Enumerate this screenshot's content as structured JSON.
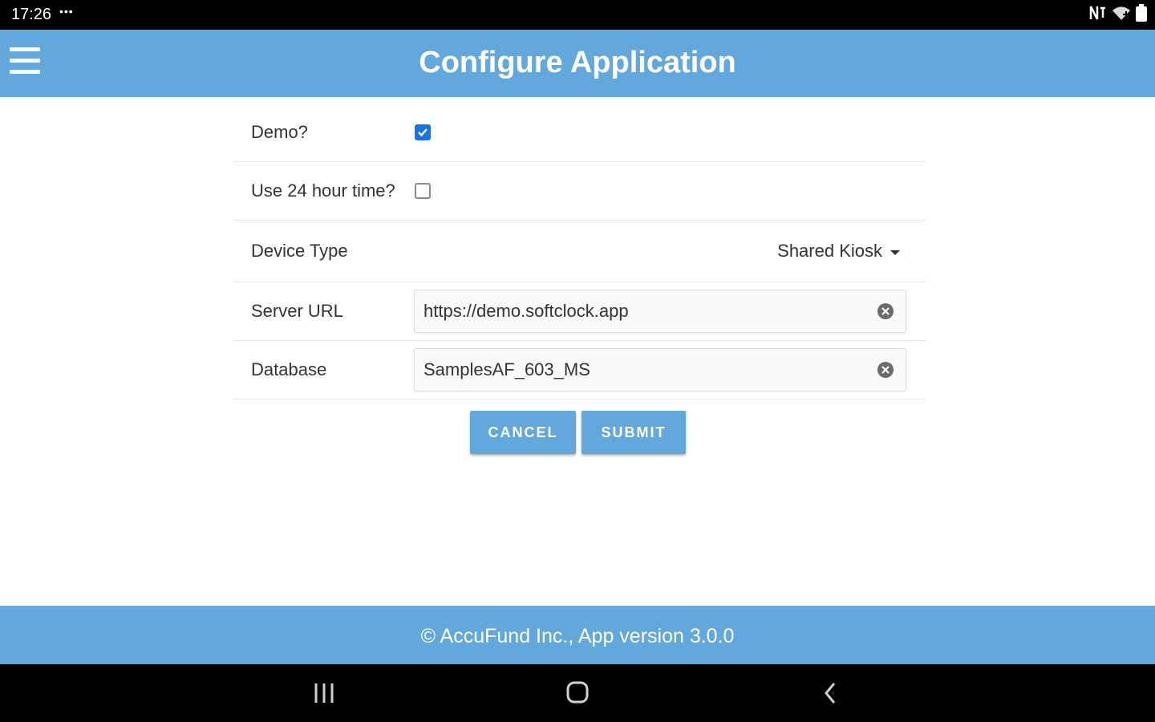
{
  "status_bar": {
    "time": "17:26",
    "dots": "•••"
  },
  "app_bar": {
    "title": "Configure Application"
  },
  "form": {
    "demo": {
      "label": "Demo?",
      "checked": true
    },
    "use_24h": {
      "label": "Use 24 hour time?",
      "checked": false
    },
    "device_type": {
      "label": "Device Type",
      "value": "Shared Kiosk"
    },
    "server_url": {
      "label": "Server URL",
      "value": "https://demo.softclock.app"
    },
    "database": {
      "label": "Database",
      "value": "SamplesAF_603_MS"
    }
  },
  "actions": {
    "cancel_label": "CANCEL",
    "submit_label": "SUBMIT"
  },
  "footer": {
    "text": "© AccuFund Inc., App version 3.0.0"
  },
  "colors": {
    "brand": "#62a8dc",
    "checkbox_checked": "#1a73e8"
  },
  "icons": [
    "hamburger-menu-icon",
    "checkmark-icon",
    "caret-down-icon",
    "clear-circle-icon",
    "nfc-icon",
    "wifi-icon",
    "battery-icon",
    "recents-icon",
    "home-icon",
    "back-icon"
  ]
}
